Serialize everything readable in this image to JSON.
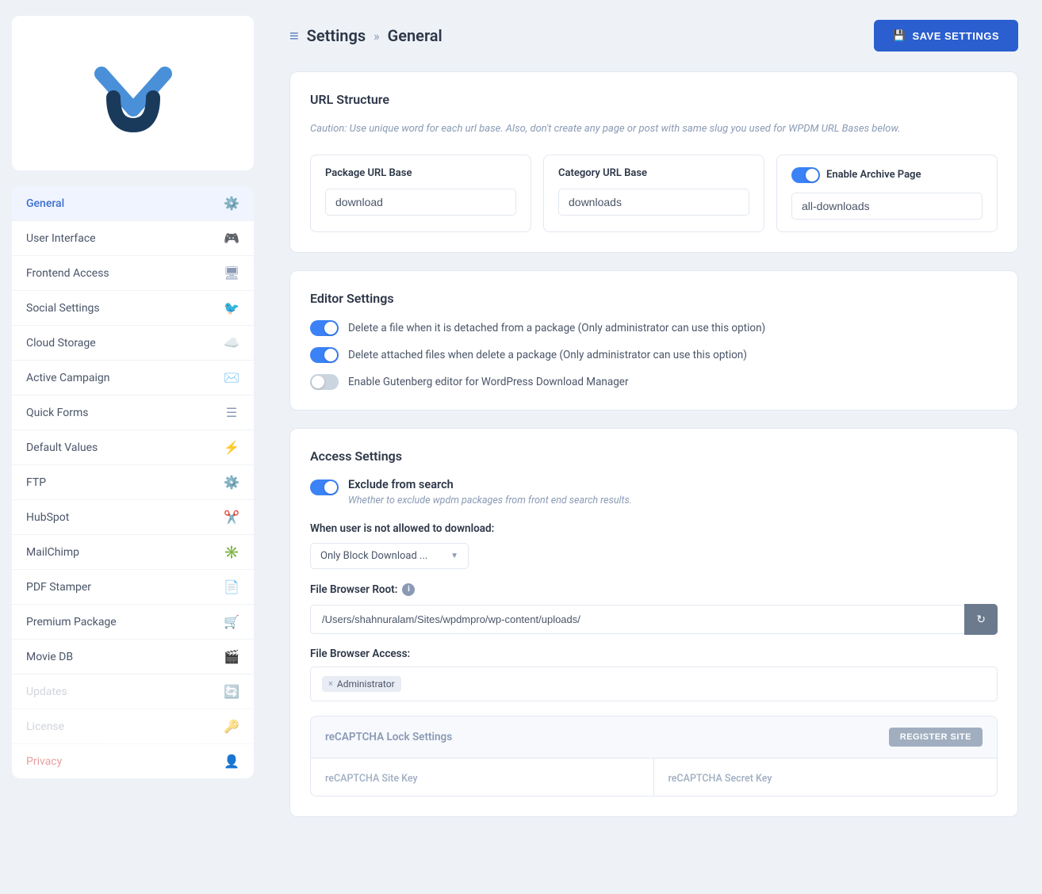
{
  "sidebar": {
    "items": [
      {
        "id": "general",
        "label": "General",
        "icon": "⚙",
        "active": true
      },
      {
        "id": "user-interface",
        "label": "User Interface",
        "icon": "🎮",
        "active": false
      },
      {
        "id": "frontend-access",
        "label": "Frontend Access",
        "icon": "🖥",
        "active": false
      },
      {
        "id": "social-settings",
        "label": "Social Settings",
        "icon": "🐦",
        "active": false
      },
      {
        "id": "cloud-storage",
        "label": "Cloud Storage",
        "icon": "☁",
        "active": false
      },
      {
        "id": "active-campaign",
        "label": "Active Campaign",
        "icon": "✉",
        "active": false
      },
      {
        "id": "quick-forms",
        "label": "Quick Forms",
        "icon": "☰",
        "active": false
      },
      {
        "id": "default-values",
        "label": "Default Values",
        "icon": "⚡",
        "active": false
      },
      {
        "id": "ftp",
        "label": "FTP",
        "icon": "⚙",
        "active": false
      },
      {
        "id": "hubspot",
        "label": "HubSpot",
        "icon": "✂",
        "active": false
      },
      {
        "id": "mailchimp",
        "label": "MailChimp",
        "icon": "✳",
        "active": false
      },
      {
        "id": "pdf-stamper",
        "label": "PDF Stamper",
        "icon": "📄",
        "active": false
      },
      {
        "id": "premium-package",
        "label": "Premium Package",
        "icon": "🛒",
        "active": false
      },
      {
        "id": "movie-db",
        "label": "Movie DB",
        "icon": "🎬",
        "active": false
      },
      {
        "id": "updates",
        "label": "Updates",
        "icon": "🔄",
        "active": false,
        "muted": true
      },
      {
        "id": "license",
        "label": "License",
        "icon": "🔑",
        "active": false,
        "muted": true
      },
      {
        "id": "privacy",
        "label": "Privacy",
        "icon": "👤",
        "active": false,
        "pink": true
      }
    ]
  },
  "header": {
    "settings_label": "Settings",
    "arrow": "»",
    "section_label": "General",
    "save_button_label": "SAVE SETTINGS"
  },
  "url_structure": {
    "section_title": "URL Structure",
    "caution_text": "Caution: Use unique word for each url base. Also, don't create any page or post with same slug you used for WPDM URL Bases below.",
    "package_url_base_label": "Package URL Base",
    "package_url_base_value": "download",
    "category_url_base_label": "Category URL Base",
    "category_url_base_value": "downloads",
    "enable_archive_label": "Enable Archive Page",
    "enable_archive_value": "all-downloads",
    "enable_archive_toggle": true
  },
  "editor_settings": {
    "section_title": "Editor Settings",
    "toggle1_label": "Delete a file when it is detached from a package (Only administrator can use this option)",
    "toggle1_on": true,
    "toggle2_label": "Delete attached files when delete a package (Only administrator can use this option)",
    "toggle2_on": true,
    "toggle3_label": "Enable Gutenberg editor for WordPress Download Manager",
    "toggle3_on": false
  },
  "access_settings": {
    "section_title": "Access Settings",
    "exclude_search_label": "Exclude from search",
    "exclude_search_sub": "Whether to exclude wpdm packages from front end search results.",
    "exclude_search_on": true,
    "not_allowed_label": "When user is not allowed to download:",
    "dropdown_value": "Only Block Download ...",
    "dropdown_arrow": "▼",
    "file_browser_root_label": "File Browser Root:",
    "file_path": "/Users/shahnuralam/Sites/wpdmpro/wp-content/uploads/",
    "file_browser_access_label": "File Browser Access:",
    "access_tag": "Administrator",
    "recaptcha_title": "reCAPTCHA Lock Settings",
    "register_site_label": "REGISTER SITE",
    "recaptcha_site_key_label": "reCAPTCHA Site Key",
    "recaptcha_secret_key_label": "reCAPTCHA Secret Key"
  },
  "icons": {
    "settings_filter": "≡",
    "save": "💾"
  }
}
